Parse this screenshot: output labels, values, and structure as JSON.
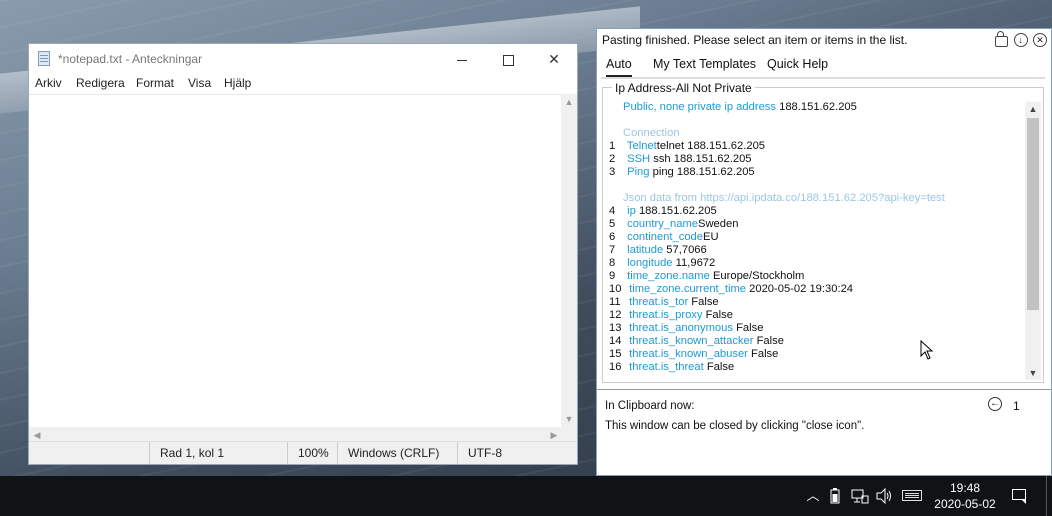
{
  "notepad": {
    "title": "*notepad.txt - Anteckningar",
    "menu": [
      "Arkiv",
      "Redigera",
      "Format",
      "Visa",
      "Hjälp"
    ],
    "status": {
      "position": "Rad 1, kol 1",
      "zoom": "100%",
      "line_endings": "Windows (CRLF)",
      "encoding": "UTF-8"
    }
  },
  "clipboard_tool": {
    "header": "Pasting finished. Please select an item or items in the list.",
    "tabs": [
      "Auto",
      "My Text Templates",
      "Quick Help"
    ],
    "active_tab": "Auto",
    "group_title": "Ip Address-All Not Private",
    "public_label": "Public, none private ip address",
    "public_value": "188.151.62.205",
    "connection_label": "Connection",
    "connection_items": [
      {
        "num": "1",
        "key": "Telnet",
        "value": "telnet 188.151.62.205"
      },
      {
        "num": "2",
        "key": "SSH",
        "value": "ssh 188.151.62.205"
      },
      {
        "num": "3",
        "key": "Ping",
        "value": "ping 188.151.62.205"
      }
    ],
    "json_source_label": "Json data from https://api.ipdata.co/188.151.62.205?api-key=test",
    "json_items": [
      {
        "num": "4",
        "key": "ip",
        "value": "188.151.62.205"
      },
      {
        "num": "5",
        "key": "country_name",
        "value": "Sweden"
      },
      {
        "num": "6",
        "key": "continent_code",
        "value": "EU"
      },
      {
        "num": "7",
        "key": "latitude",
        "value": "57,7066"
      },
      {
        "num": "8",
        "key": "longitude",
        "value": "11,9672"
      },
      {
        "num": "9",
        "key": "time_zone.name",
        "value": "Europe/Stockholm"
      },
      {
        "num": "10",
        "key": "time_zone.current_time",
        "value": "2020-05-02 19:30:24"
      },
      {
        "num": "11",
        "key": "threat.is_tor",
        "value": "False"
      },
      {
        "num": "12",
        "key": "threat.is_proxy",
        "value": "False"
      },
      {
        "num": "13",
        "key": "threat.is_anonymous",
        "value": "False"
      },
      {
        "num": "14",
        "key": "threat.is_known_attacker",
        "value": "False"
      },
      {
        "num": "15",
        "key": "threat.is_known_abuser",
        "value": "False"
      },
      {
        "num": "16",
        "key": "threat.is_threat",
        "value": "False"
      }
    ],
    "clipboard_label": "In Clipboard now:",
    "clipboard_count": "1",
    "close_note": "This window can be closed by clicking \"close icon\".",
    "icons": [
      "lock-icon",
      "download-icon",
      "close-icon"
    ]
  },
  "taskbar": {
    "time": "19:48",
    "date": "2020-05-02",
    "tray_icons": [
      "chevron-up-icon",
      "battery-icon",
      "network-icon",
      "volume-icon",
      "keyboard-icon",
      "notification-icon"
    ]
  },
  "colors": {
    "key_blue": "#1e9ad6",
    "dim_blue": "#9cc6e2",
    "taskbar": "#101216"
  }
}
